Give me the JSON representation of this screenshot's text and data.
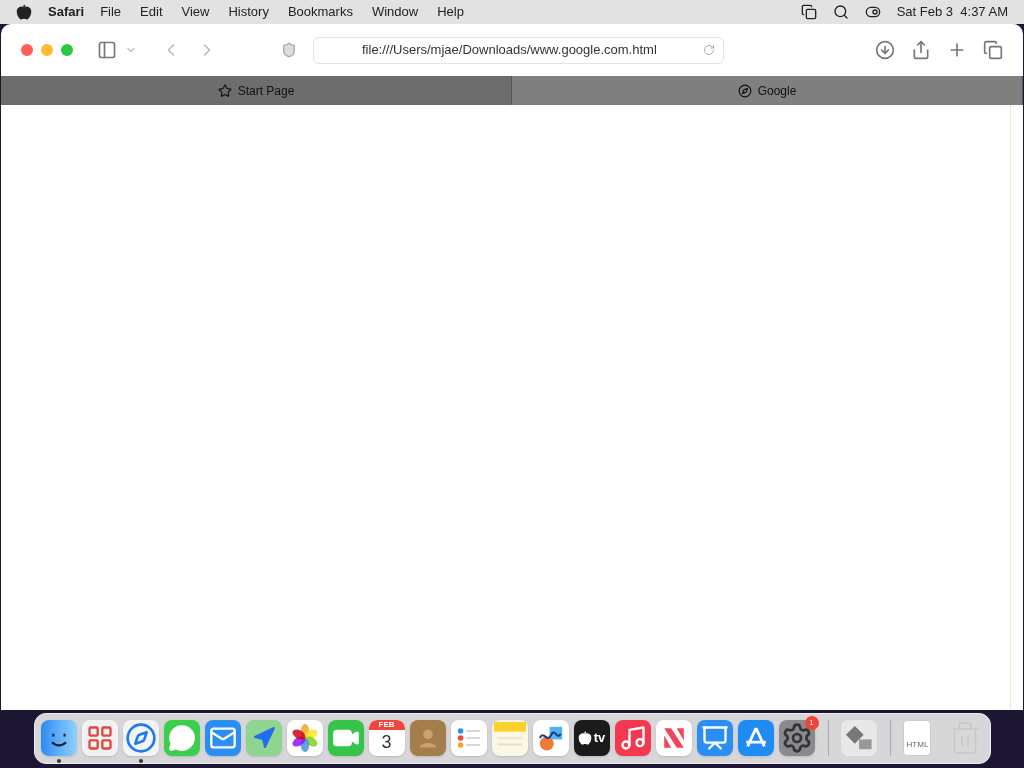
{
  "menu_bar": {
    "app": "Safari",
    "items": [
      "File",
      "Edit",
      "View",
      "History",
      "Bookmarks",
      "Window",
      "Help"
    ],
    "clock": "Sat Feb 3  4:37 AM"
  },
  "toolbar": {
    "address": "file:///Users/mjae/Downloads/www.google.com.html"
  },
  "tabs": [
    {
      "label": "Start Page",
      "kind": "star",
      "selected": false
    },
    {
      "label": "Google",
      "kind": "compass",
      "selected": true
    }
  ],
  "dock": {
    "apps": [
      {
        "kind": "finder",
        "running": true
      },
      {
        "kind": "launchpad",
        "running": false
      },
      {
        "kind": "safari",
        "running": true
      },
      {
        "kind": "messages",
        "running": false
      },
      {
        "kind": "mail",
        "running": false
      },
      {
        "kind": "maps",
        "running": false
      },
      {
        "kind": "photos",
        "running": false
      },
      {
        "kind": "facetime",
        "running": false
      },
      {
        "kind": "calendar",
        "running": false,
        "month": "FEB",
        "day": "3"
      },
      {
        "kind": "contacts",
        "running": false
      },
      {
        "kind": "reminders",
        "running": false
      },
      {
        "kind": "notes",
        "running": false
      },
      {
        "kind": "freeform",
        "running": false
      },
      {
        "kind": "tv",
        "running": false,
        "label": "tv"
      },
      {
        "kind": "music",
        "running": false
      },
      {
        "kind": "news",
        "running": false
      },
      {
        "kind": "keynote",
        "running": false
      },
      {
        "kind": "appstore",
        "running": false
      },
      {
        "kind": "settings",
        "running": false,
        "badge": "1"
      }
    ],
    "others": [
      {
        "kind": "migration"
      },
      {
        "kind": "document",
        "label": "HTML"
      },
      {
        "kind": "trash"
      }
    ]
  }
}
